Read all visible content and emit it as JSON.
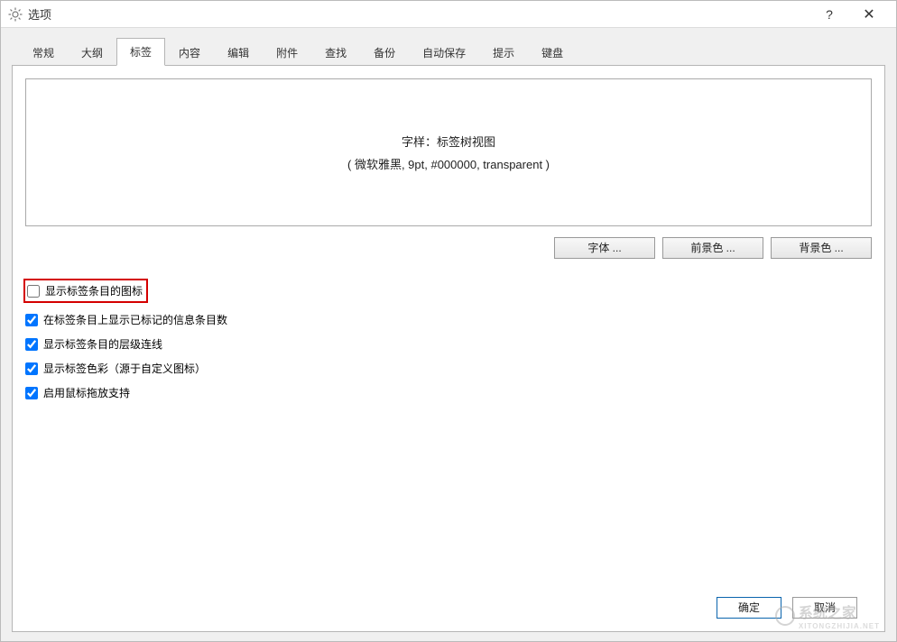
{
  "window": {
    "title": "选项"
  },
  "tabs": {
    "items": [
      {
        "label": "常规"
      },
      {
        "label": "大纲"
      },
      {
        "label": "标签"
      },
      {
        "label": "内容"
      },
      {
        "label": "编辑"
      },
      {
        "label": "附件"
      },
      {
        "label": "查找"
      },
      {
        "label": "备份"
      },
      {
        "label": "自动保存"
      },
      {
        "label": "提示"
      },
      {
        "label": "键盘"
      }
    ],
    "active_index": 2
  },
  "preview": {
    "line1": "字样：标签树视图",
    "line2": "( 微软雅黑, 9pt, #000000, transparent )"
  },
  "font_buttons": {
    "font": "字体 ...",
    "foreground": "前景色 ...",
    "background": "背景色 ..."
  },
  "checks": [
    {
      "label": "显示标签条目的图标",
      "checked": false,
      "highlight": true
    },
    {
      "label": "在标签条目上显示已标记的信息条目数",
      "checked": true,
      "highlight": false
    },
    {
      "label": "显示标签条目的层级连线",
      "checked": true,
      "highlight": false
    },
    {
      "label": "显示标签色彩（源于自定义图标）",
      "checked": true,
      "highlight": false
    },
    {
      "label": "启用鼠标拖放支持",
      "checked": true,
      "highlight": false
    }
  ],
  "footer": {
    "ok": "确定",
    "cancel": "取消"
  },
  "watermark": {
    "text": "系统之家",
    "sub": "XITONGZHIJIA.NET"
  }
}
